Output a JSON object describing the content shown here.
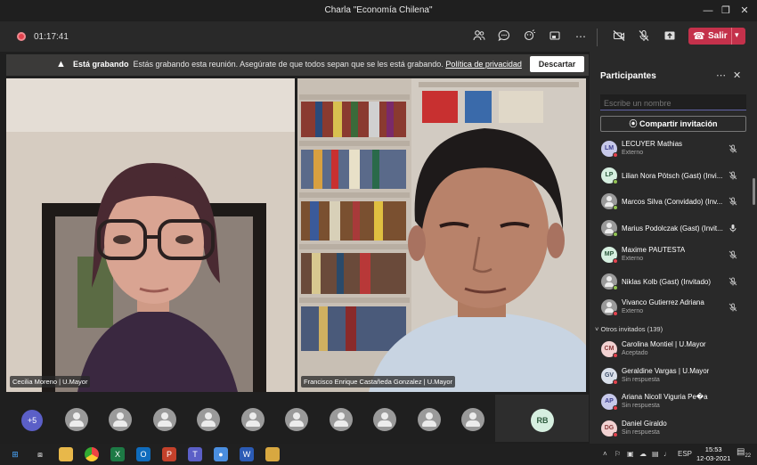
{
  "window": {
    "title": "Charla \"Economía Chilena\""
  },
  "toolbar": {
    "timer": "01:17:41",
    "leave_label": "Salir"
  },
  "banner": {
    "bold": "Está grabando",
    "message": "Estás grabando esta reunión. Asegúrate de que todos sepan que se les está grabando.",
    "link": "Política de privacidad",
    "dismiss": "Descartar"
  },
  "videos": [
    {
      "name": "Cecilia Moreno | U.Mayor"
    },
    {
      "name": "Francisco Enrique Castañeda Gonzalez | U.Mayor"
    }
  ],
  "strip": {
    "overflow": "+5",
    "self_initials": "RB"
  },
  "panel": {
    "title": "Participantes",
    "search_placeholder": "Escribe un nombre",
    "share_label": "Compartir invitación",
    "participants": [
      {
        "initials": "LM",
        "name": "LECUYER Mathias",
        "sub": "Externo",
        "avatar_bg": "#c7c9ea",
        "avatar_fg": "#3d3f8f",
        "status": "red",
        "mic": "muted"
      },
      {
        "initials": "LP",
        "name": "Lilian Nora Pötsch (Gast) (Invi...",
        "sub": "",
        "avatar_bg": "#d6efe0",
        "avatar_fg": "#2d5a3d",
        "status": "green",
        "mic": "muted"
      },
      {
        "initials": "",
        "name": "Marcos Silva (Convidado) (Inv...",
        "sub": "",
        "avatar_bg": "",
        "avatar_fg": "",
        "status": "green",
        "mic": "muted"
      },
      {
        "initials": "",
        "name": "Marius Podolczak (Gast) (Invit...",
        "sub": "",
        "avatar_bg": "",
        "avatar_fg": "",
        "status": "green",
        "mic": "on"
      },
      {
        "initials": "MP",
        "name": "Maxime PAUTESTA",
        "sub": "Externo",
        "avatar_bg": "#d6efe0",
        "avatar_fg": "#2d5a3d",
        "status": "red",
        "mic": "muted"
      },
      {
        "initials": "",
        "name": "Niklas Kolb (Gast) (Invitado)",
        "sub": "",
        "avatar_bg": "",
        "avatar_fg": "",
        "status": "green",
        "mic": "muted"
      },
      {
        "initials": "",
        "name": "Vivanco Gutierrez Adriana",
        "sub": "Externo",
        "avatar_bg": "",
        "avatar_fg": "",
        "status": "red",
        "mic": "muted"
      }
    ],
    "others_label": "Otros invitados (139)",
    "invited": [
      {
        "initials": "CM",
        "name": "Carolina Montiel | U.Mayor",
        "sub": "Aceptado",
        "avatar_bg": "#f2d2d2",
        "avatar_fg": "#8a3a3a",
        "status": "red"
      },
      {
        "initials": "GV",
        "name": "Geraldine Vargas | U.Mayor",
        "sub": "Sin respuesta",
        "avatar_bg": "#d9e0ea",
        "avatar_fg": "#3d4f6a",
        "status": "red"
      },
      {
        "initials": "AP",
        "name": "Ariana Nicoll Viguria Pe�a",
        "sub": "Sin respuesta",
        "avatar_bg": "#c7c9ea",
        "avatar_fg": "#3d3f8f",
        "status": "red"
      },
      {
        "initials": "DG",
        "name": "Daniel Giraldo",
        "sub": "Sin respuesta",
        "avatar_bg": "#f2d2d2",
        "avatar_fg": "#8a3a3a",
        "status": "red"
      }
    ]
  },
  "taskbar": {
    "language": "ESP",
    "time": "15:53",
    "date": "12-03-2021",
    "notifications": "22"
  },
  "colors": {
    "accent": "#5b5fc7",
    "leave": "#c4314b",
    "status_busy": "#e3424d",
    "status_available": "#92c353"
  }
}
